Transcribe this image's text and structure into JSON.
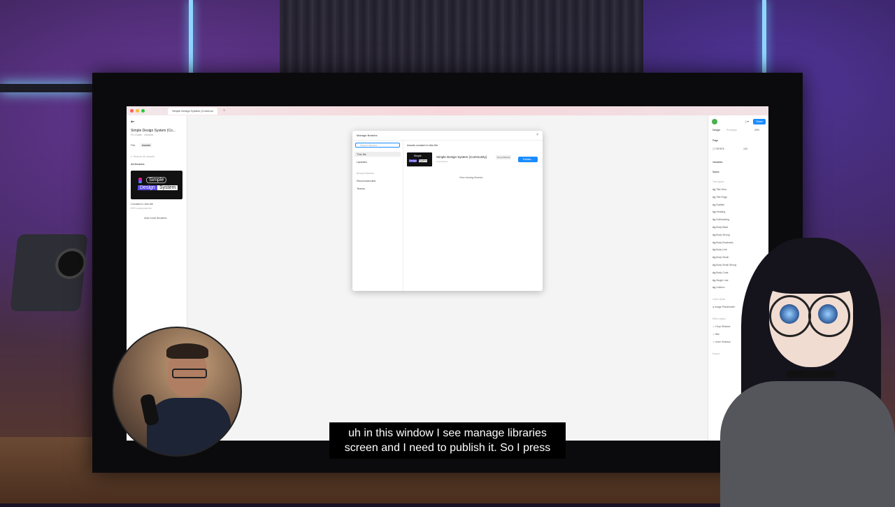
{
  "window": {
    "tab_title": "Simple Design System (Commun",
    "new_tab": "+"
  },
  "left_panel": {
    "file_name": "Simple Design System (Co...",
    "file_sub": "Pro Drafts · Libraries",
    "tab_file": "File",
    "tab_assets": "Assets",
    "search_placeholder": "Search all assets",
    "section": "All libraries",
    "thumb_word1": "Simple",
    "thumb_word2": "Design",
    "thumb_word3": "System",
    "thumb_caption": "Created in this file",
    "thumb_meta": "999 components",
    "add_more": "Add more libraries"
  },
  "modal": {
    "title": "Manage libraries",
    "close": "×",
    "search_placeholder": "Search libraries",
    "nav": [
      "This file",
      "Updates"
    ],
    "section_label": "Browse libraries",
    "nav2": [
      "Recommended",
      "Teams"
    ],
    "main_heading": "Assets created in this file",
    "library_name": "Simple Design System (Community)",
    "library_meta": "Unpublished",
    "badge": "Not published",
    "publish": "Publish...",
    "view_missing": "View missing libraries"
  },
  "right_panel": {
    "share": "Share",
    "tab_design": "Design",
    "tab_prototype": "Prototype",
    "zoom": "25%",
    "page_label": "Page",
    "page_color": "F5F5F5",
    "page_opacity": "100",
    "variables": "Variables",
    "styles": "Styles",
    "text_styles_label": "Text styles",
    "text_styles": [
      "Title Hero",
      "Title Page",
      "Subtitle",
      "Heading",
      "Subheading",
      "Body Base",
      "Body Strong",
      "Body Emphasis",
      "Body Link",
      "Body Small",
      "Body Small Strong",
      "Body Code",
      "Single Line",
      "Uniform"
    ],
    "color_styles_label": "Color styles",
    "color_style": "Image Placeholder",
    "effect_styles_label": "Effect styles",
    "effect_styles": [
      "Drop Shadow",
      "Blur",
      "Inner Shadow"
    ],
    "export": "Export"
  },
  "caption": {
    "line1": "uh in this window I see manage libraries",
    "line2": "screen and I need to publish it. So I press"
  }
}
